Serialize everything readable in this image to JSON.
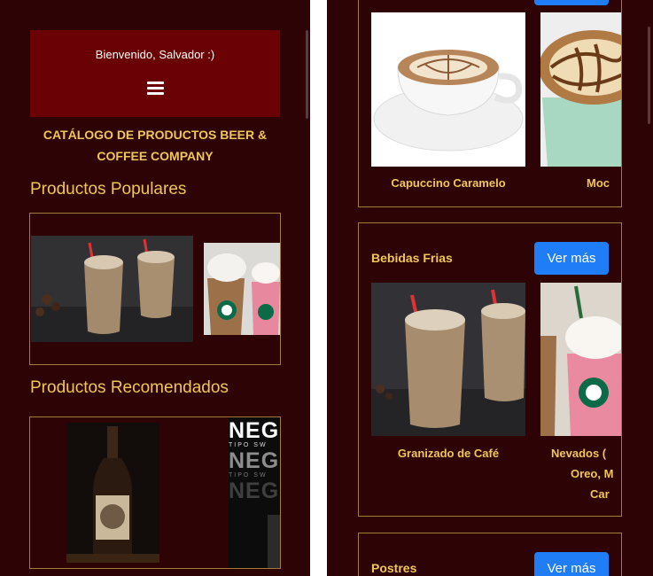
{
  "left": {
    "welcome": "Bienvenido, Salvador :)",
    "catalog_title_line1": "CATÁLOGO DE PRODUCTOS BEER &",
    "catalog_title_line2": "COFFEE COMPANY",
    "popular_heading": "Productos Populares",
    "recommended_heading": "Productos Recomendados",
    "neg_logo_text": "NEG",
    "neg_logo_subtext": "TIPO SW"
  },
  "right": {
    "top_card": {
      "products": [
        "Capuccino Caramelo",
        "Moc"
      ]
    },
    "cold_drinks": {
      "title": "Bebidas Frias",
      "more_label": "Ver más",
      "product_1": "Granizado de Café",
      "product_2_line1": "Nevados (",
      "product_2_line2": "Oreo, M",
      "product_2_line3": "Car"
    },
    "desserts": {
      "title": "Postres",
      "more_label": "Ver más"
    }
  },
  "colors": {
    "background": "#2d0305",
    "header_red": "#6a0104",
    "gold_text": "#f0c659",
    "frame_border": "#a27a3c",
    "button_blue": "#1e7df7"
  }
}
